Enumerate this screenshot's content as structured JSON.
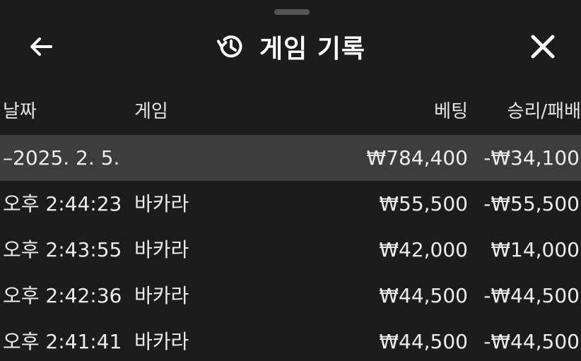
{
  "header": {
    "title": "게임 기록",
    "back_icon": "arrow-left-icon",
    "history_icon": "history-icon",
    "close_icon": "close-icon"
  },
  "table": {
    "columns": {
      "date": "날짜",
      "game": "게임",
      "bet": "베팅",
      "result": "승리/패배"
    },
    "group": {
      "label": "–2025. 2. 5.",
      "bet": "₩784,400",
      "result": "-₩34,100"
    },
    "rows": [
      {
        "time": "오후 2:44:23",
        "game": "바카라",
        "bet": "₩55,500",
        "result": "-₩55,500"
      },
      {
        "time": "오후 2:43:55",
        "game": "바카라",
        "bet": "₩42,000",
        "result": "₩14,000"
      },
      {
        "time": "오후 2:42:36",
        "game": "바카라",
        "bet": "₩44,500",
        "result": "-₩44,500"
      },
      {
        "time": "오후 2:41:41",
        "game": "바카라",
        "bet": "₩44,500",
        "result": "-₩44,500"
      }
    ]
  },
  "colors": {
    "background": "#1c1c1c",
    "group_row": "#3d3d3d",
    "text": "#ececec"
  }
}
